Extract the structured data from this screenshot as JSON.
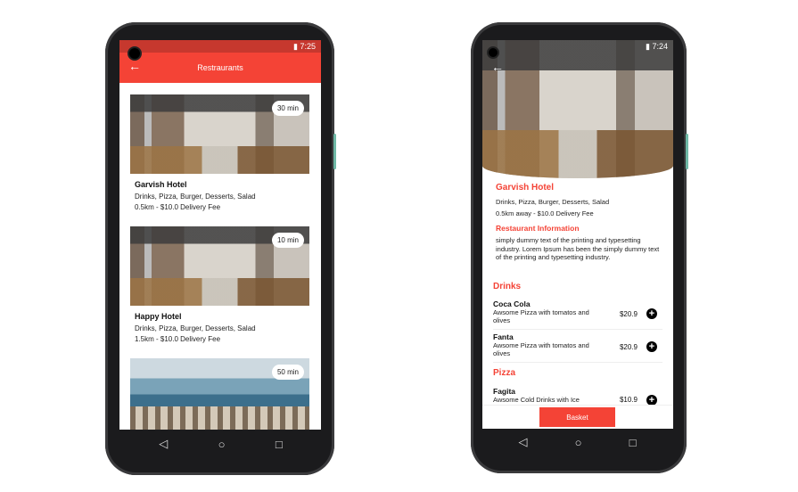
{
  "status": {
    "time_left": "7:25",
    "time_right": "7:24"
  },
  "list_screen": {
    "title": "Restraurants",
    "cards": [
      {
        "name": "Garvish Hotel",
        "cuisines": "Drinks, Pizza, Burger, Desserts, Salad",
        "delivery": "0.5km - $10.0 Delivery Fee",
        "time": "30 min"
      },
      {
        "name": "Happy Hotel",
        "cuisines": "Drinks, Pizza, Burger, Desserts, Salad",
        "delivery": "1.5km - $10.0 Delivery Fee",
        "time": "10 min"
      },
      {
        "time": "50 min"
      }
    ]
  },
  "detail_screen": {
    "name": "Garvish Hotel",
    "cuisines": "Drinks, Pizza, Burger, Desserts, Salad",
    "delivery": "0.5km away - $10.0 Delivery Fee",
    "info_heading": "Restaurant Information",
    "info_text": "simply dummy text of the printing and typesetting industry. Lorem Ipsum has been the simply dummy text of the printing and typesetting industry.",
    "sections": [
      {
        "title": "Drinks",
        "items": [
          {
            "name": "Coca Cola",
            "desc": "Awsome Pizza with tomatos and olives",
            "price": "$20.9"
          },
          {
            "name": "Fanta",
            "desc": "Awsome Pizza with tomatos and olives",
            "price": "$20.9"
          }
        ]
      },
      {
        "title": "Pizza",
        "items": [
          {
            "name": "Fagita",
            "desc": "Awsome Cold Drinks with Ice",
            "price": "$10.9"
          }
        ]
      }
    ],
    "basket_label": "Basket"
  },
  "colors": {
    "accent": "#f44336",
    "status_bar": "#c6382e"
  },
  "icons": {
    "back": "arrow-left-icon",
    "add": "plus-circle-icon",
    "nav": [
      "back-triangle-icon",
      "home-circle-icon",
      "recents-square-icon"
    ]
  }
}
